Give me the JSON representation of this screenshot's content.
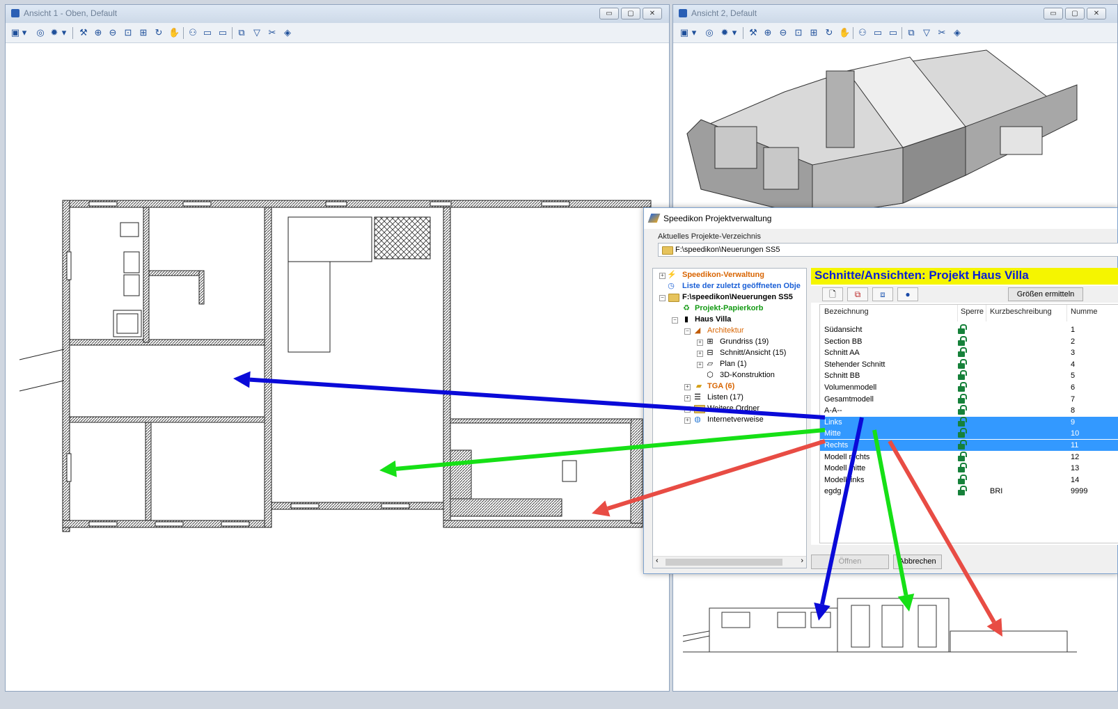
{
  "window_left": {
    "title": "Ansicht 1 - Oben, Default"
  },
  "window_right": {
    "title": "Ansicht 2, Default"
  },
  "window_buttons": {
    "minimize": "▭",
    "restore": "▢",
    "close": "✕"
  },
  "dialog": {
    "title": "Speedikon Projektverwaltung",
    "current_dir_label": "Aktuelles Projekte-Verzeichnis",
    "current_dir_value": "F:\\speedikon\\Neuerungen SS5",
    "tree": [
      {
        "label": "Speedikon-Verwaltung",
        "color": "#d86400"
      },
      {
        "label": "Liste der zuletzt geöffneten Obje",
        "color": "#1a5fd6"
      },
      {
        "label": "F:\\speedikon\\Neuerungen SS5",
        "color": "#000000"
      },
      {
        "label": "Projekt-Papierkorb",
        "color": "#139a13"
      },
      {
        "label": "Haus Villa",
        "color": "#000000"
      },
      {
        "label": "Architektur",
        "color": "#d86400"
      },
      {
        "label": "Grundriss (19)",
        "color": "#000000"
      },
      {
        "label": "Schnitt/Ansicht (15)",
        "color": "#000000"
      },
      {
        "label": "Plan (1)",
        "color": "#000000"
      },
      {
        "label": "3D-Konstruktion",
        "color": "#000000"
      },
      {
        "label": "TGA (6)",
        "color": "#d86400"
      },
      {
        "label": "Listen (17)",
        "color": "#000000"
      },
      {
        "label": "Weitere Ordner",
        "color": "#000000"
      },
      {
        "label": "Internetverweise",
        "color": "#000000"
      }
    ],
    "panel_title": "Schnitte/Ansichten: Projekt Haus Villa",
    "groessen_button": "Größen ermitteln",
    "columns": [
      "Bezeichnung",
      "Sperre",
      "Kurzbeschreibung",
      "Numme"
    ],
    "rows": [
      {
        "name": "Südansicht",
        "desc": "",
        "num": "1",
        "selected": false
      },
      {
        "name": "Section BB",
        "desc": "",
        "num": "2",
        "selected": false
      },
      {
        "name": "Schnitt AA",
        "desc": "",
        "num": "3",
        "selected": false
      },
      {
        "name": "Stehender Schnitt",
        "desc": "",
        "num": "4",
        "selected": false
      },
      {
        "name": "Schnitt BB",
        "desc": "",
        "num": "5",
        "selected": false
      },
      {
        "name": "Volumenmodell",
        "desc": "",
        "num": "6",
        "selected": false
      },
      {
        "name": "Gesamtmodell",
        "desc": "",
        "num": "7",
        "selected": false
      },
      {
        "name": "A-A--",
        "desc": "",
        "num": "8",
        "selected": false
      },
      {
        "name": "Links",
        "desc": "",
        "num": "9",
        "selected": true
      },
      {
        "name": "Mitte",
        "desc": "",
        "num": "10",
        "selected": true
      },
      {
        "name": "Rechts",
        "desc": "",
        "num": "11",
        "selected": true
      },
      {
        "name": "Modell rechts",
        "desc": "",
        "num": "12",
        "selected": false
      },
      {
        "name": "Modell mitte",
        "desc": "",
        "num": "13",
        "selected": false
      },
      {
        "name": "Modell links",
        "desc": "",
        "num": "14",
        "selected": false
      },
      {
        "name": "egdg",
        "desc": "BRI",
        "num": "9999",
        "selected": false
      }
    ],
    "open_button": "Öffnen",
    "cancel_button": "Abbrechen"
  },
  "colors": {
    "arrow_blue": "#0a0ad8",
    "arrow_green": "#16e016",
    "arrow_red": "#e84c44",
    "selection": "#3399ff",
    "wall_hatch": "#444444"
  }
}
